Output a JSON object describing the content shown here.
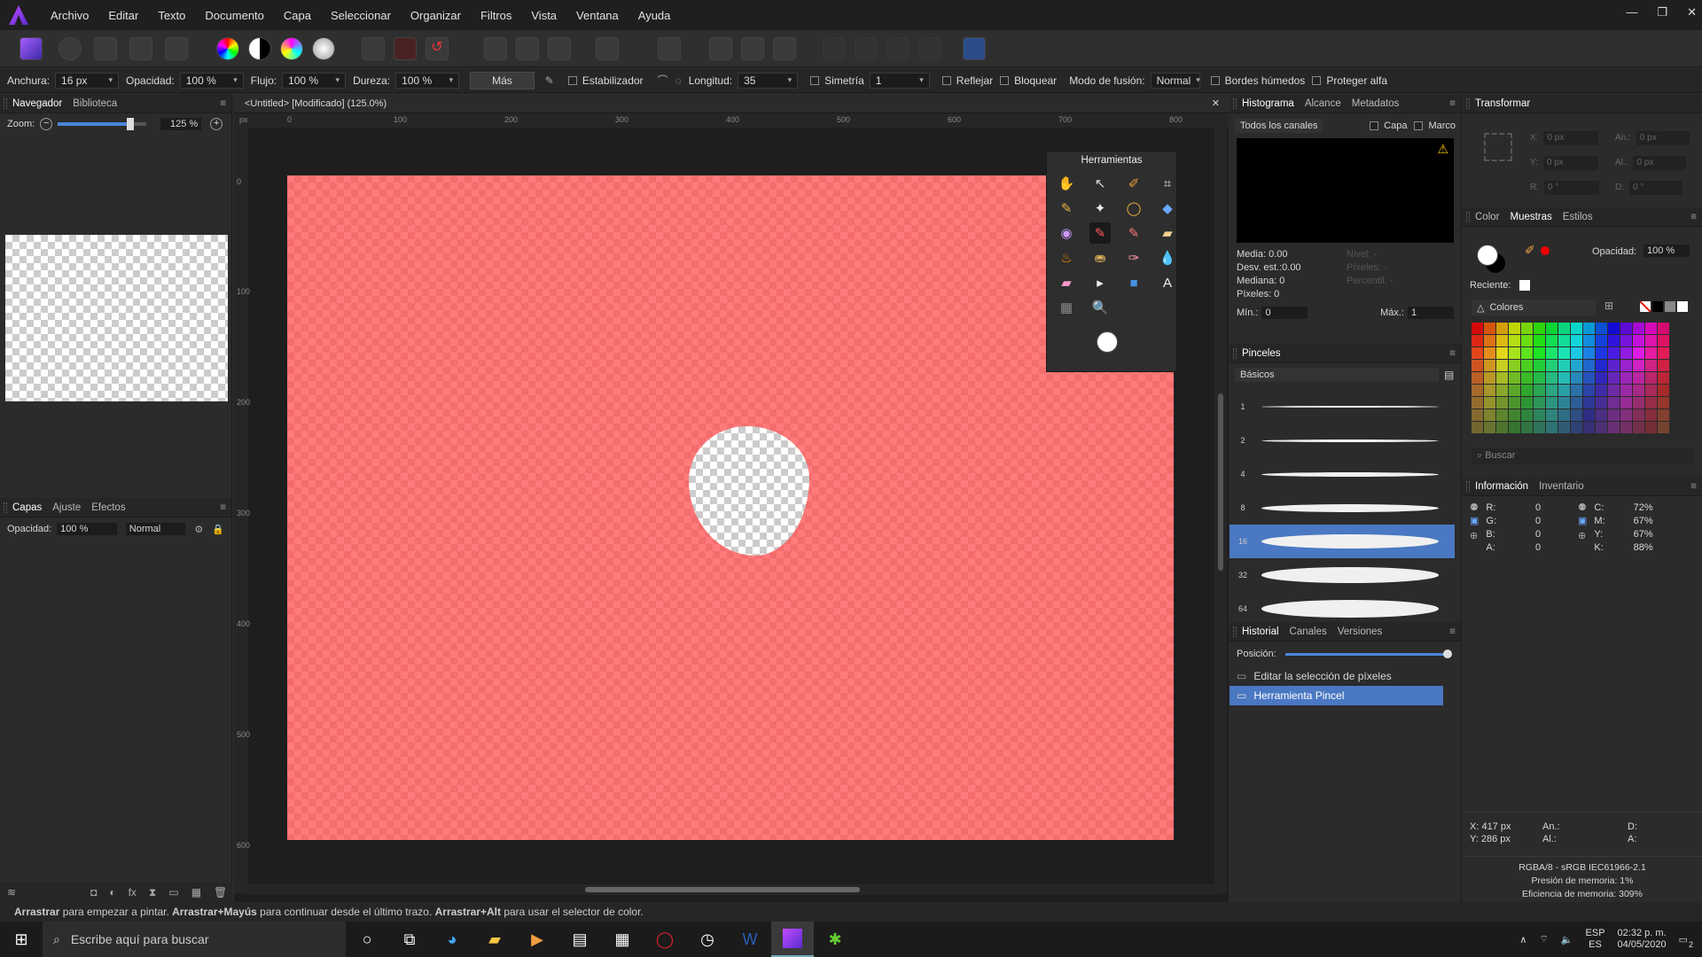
{
  "menu": [
    "Archivo",
    "Editar",
    "Texto",
    "Documento",
    "Capa",
    "Seleccionar",
    "Organizar",
    "Filtros",
    "Vista",
    "Ventana",
    "Ayuda"
  ],
  "window_controls": [
    "—",
    "❐",
    "✕"
  ],
  "context": {
    "width_label": "Anchura:",
    "width_val": "16 px",
    "opacity_label": "Opacidad:",
    "opacity_val": "100 %",
    "flow_label": "Flujo:",
    "flow_val": "100 %",
    "hardness_label": "Dureza:",
    "hardness_val": "100 %",
    "more": "Más",
    "stabilizer": "Estabilizador",
    "length_label": "Longitud:",
    "length_val": "35",
    "symmetry": "Simetría",
    "sym_val": "1",
    "mirror": "Reflejar",
    "lock": "Bloquear",
    "blend_label": "Modo de fusión:",
    "blend_val": "Normal",
    "wet": "Bordes húmedos",
    "alpha": "Proteger alfa"
  },
  "navigator": {
    "tabs": [
      "Navegador",
      "Biblioteca"
    ],
    "zoom_label": "Zoom:",
    "zoom_val": "125 %"
  },
  "layers": {
    "tabs": [
      "Capas",
      "Ajuste",
      "Efectos"
    ],
    "opacity_label": "Opacidad:",
    "opacity_val": "100 %",
    "blend": "Normal"
  },
  "doc": {
    "title": "<Untitled> [Modificado] (125.0%)",
    "close": "✕",
    "ruler_unit": "px",
    "hticks": [
      "0",
      "100",
      "200",
      "300",
      "400",
      "500",
      "600",
      "700",
      "800"
    ],
    "vticks": [
      "0",
      "100",
      "200",
      "300",
      "400",
      "500",
      "600"
    ]
  },
  "tools": {
    "title": "Herramientas"
  },
  "histogram": {
    "tabs": [
      "Histograma",
      "Alcance",
      "Metadatos"
    ],
    "channel": "Todos los canales",
    "layer": "Capa",
    "frame": "Marco",
    "mean": "Media: 0.00",
    "std": "Desv. est.:0.00",
    "median": "Mediana: 0",
    "pixels": "Píxeles: 0",
    "levels": "Nivel: -",
    "lpixels": "Píxeles: -",
    "percentile": "Percentil: -",
    "min_label": "Mín.:",
    "min_val": "0",
    "max_label": "Máx.:",
    "max_val": "1"
  },
  "brushes": {
    "title": "Pinceles",
    "category": "Básicos",
    "sizes": [
      "1",
      "2",
      "4",
      "8",
      "16",
      "32",
      "64"
    ]
  },
  "history": {
    "tabs": [
      "Historial",
      "Canales",
      "Versiones"
    ],
    "position_label": "Posición:",
    "items": [
      "Editar la selección de píxeles",
      "Herramienta Pincel"
    ]
  },
  "transform": {
    "title": "Transformar",
    "x": "0 px",
    "y": "0 px",
    "w": "0 px",
    "h": "0 px",
    "r": "0 °",
    "s": "0 °",
    "lx": "X:",
    "ly": "Y:",
    "lw": "An.:",
    "lh": "Al.:",
    "lr": "R:",
    "ls": "D:"
  },
  "color": {
    "tabs": [
      "Color",
      "Muestras",
      "Estilos"
    ],
    "opacity_label": "Opacidad:",
    "opacity_val": "100 %",
    "recent": "Reciente:",
    "palette": "Colores",
    "search": "Buscar"
  },
  "info": {
    "tabs": [
      "Información",
      "Inventario"
    ],
    "r": "R:",
    "g": "G:",
    "b": "B:",
    "a": "A:",
    "rv": "0",
    "gv": "0",
    "bv": "0",
    "av": "0",
    "c": "C:",
    "m": "M:",
    "y": "Y:",
    "k": "K:",
    "cv": "72%",
    "mv": "67%",
    "yv": "67%",
    "kv": "88%",
    "x": "X: 417 px",
    "yy": "Y: 286 px",
    "an": "An.:",
    "al": "Al.:",
    "d": "D:",
    "dA": "A:",
    "format": "RGBA/8 - sRGB IEC61966-2.1",
    "mem": "Presión de memoria: 1%",
    "eff": "Eficiencia de memoria: 309%"
  },
  "status": {
    "b1": "Arrastrar",
    "t1": " para empezar a pintar. ",
    "b2": "Arrastrar+Mayús",
    "t2": " para continuar desde el último trazo. ",
    "b3": "Arrastrar+Alt",
    "t3": " para usar el selector de color."
  },
  "taskbar": {
    "search": "Escribe aquí para buscar",
    "lang1": "ESP",
    "lang2": "ES",
    "time": "02:32 p. m.",
    "date": "04/05/2020",
    "notif": "2"
  }
}
